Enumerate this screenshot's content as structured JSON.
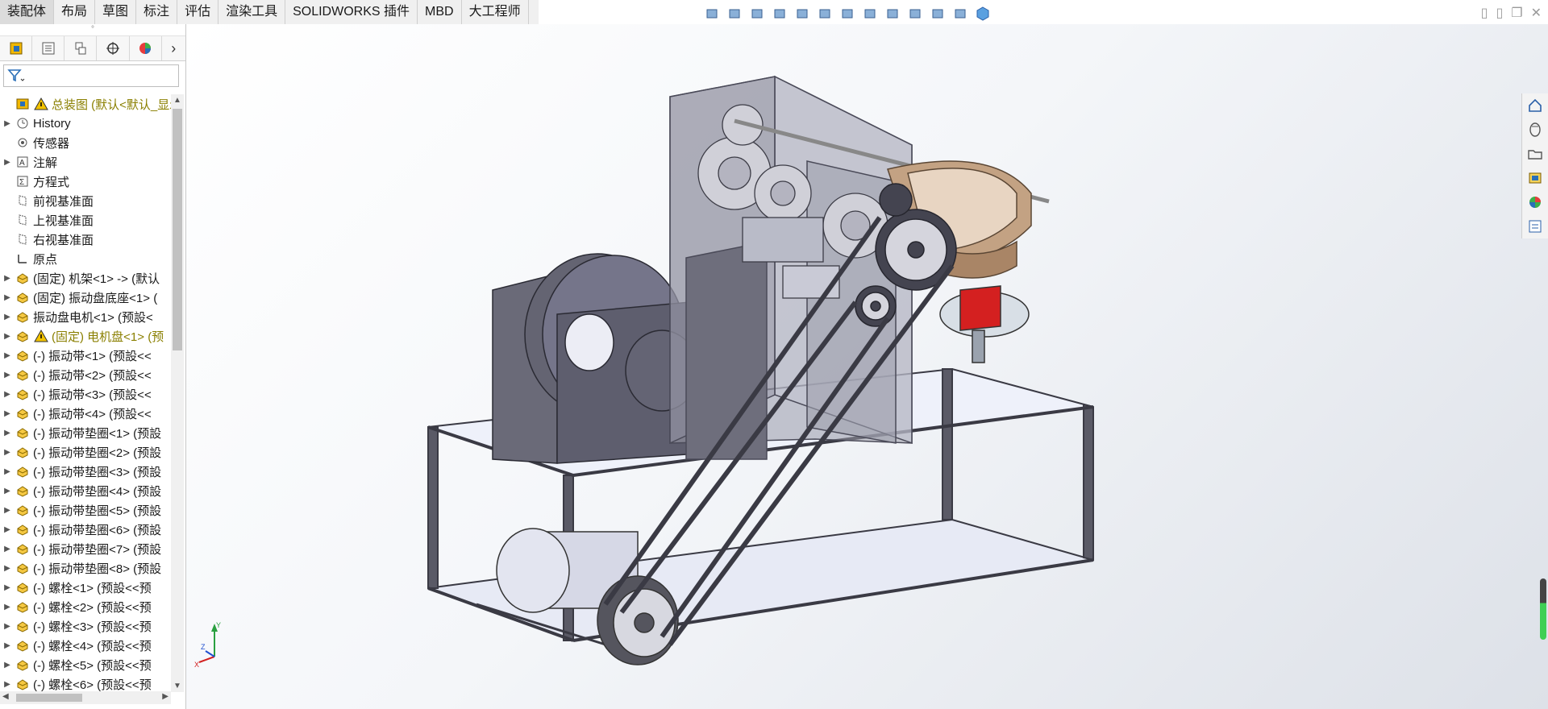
{
  "tabs": [
    {
      "label": "装配体",
      "active": true
    },
    {
      "label": "布局"
    },
    {
      "label": "草图"
    },
    {
      "label": "标注"
    },
    {
      "label": "评估"
    },
    {
      "label": "渲染工具"
    },
    {
      "label": "SOLIDWORKS 插件"
    },
    {
      "label": "MBD"
    },
    {
      "label": "大工程师"
    }
  ],
  "hud_icons": [
    "view-orientation-icon",
    "zoom-to-fit-icon",
    "zoom-area-icon",
    "previous-view-icon",
    "section-view-icon",
    "dynamic-annotation-icon",
    "view-orientation-dropdown-icon",
    "display-style-icon",
    "hide-show-icon",
    "edit-appearance-icon",
    "apply-scene-icon",
    "view-settings-icon",
    "cube-icon"
  ],
  "panel_tabs": [
    "feature-manager-icon",
    "property-manager-icon",
    "configuration-manager-icon",
    "dimxpert-icon",
    "display-manager-icon"
  ],
  "tree": [
    {
      "label": "总装图  (默认<默认_显示",
      "type": "root",
      "warn": true
    },
    {
      "label": "History",
      "type": "history",
      "expand": true
    },
    {
      "label": "传感器",
      "type": "sensor"
    },
    {
      "label": "注解",
      "type": "annotation",
      "expand": true
    },
    {
      "label": "方程式",
      "type": "equation"
    },
    {
      "label": "前视基准面",
      "type": "plane"
    },
    {
      "label": "上视基准面",
      "type": "plane"
    },
    {
      "label": "右视基准面",
      "type": "plane"
    },
    {
      "label": "原点",
      "type": "origin"
    },
    {
      "label": "(固定) 机架<1> -> (默认",
      "type": "part",
      "expand": true
    },
    {
      "label": "(固定) 振动盘底座<1> (",
      "type": "part",
      "expand": true
    },
    {
      "label": "振动盘电机<1> (预設<",
      "type": "part",
      "expand": true
    },
    {
      "label": "(固定) 电机盘<1> (预",
      "type": "part",
      "expand": true,
      "warn": true
    },
    {
      "label": "(-) 振动带<1> (预設<<",
      "type": "part",
      "expand": true
    },
    {
      "label": "(-) 振动带<2> (预設<<",
      "type": "part",
      "expand": true
    },
    {
      "label": "(-) 振动带<3> (预設<<",
      "type": "part",
      "expand": true
    },
    {
      "label": "(-) 振动带<4> (预設<<",
      "type": "part",
      "expand": true
    },
    {
      "label": "(-) 振动带垫圈<1> (预設",
      "type": "part",
      "expand": true
    },
    {
      "label": "(-) 振动带垫圈<2> (预設",
      "type": "part",
      "expand": true
    },
    {
      "label": "(-) 振动带垫圈<3> (预設",
      "type": "part",
      "expand": true
    },
    {
      "label": "(-) 振动带垫圈<4> (预設",
      "type": "part",
      "expand": true
    },
    {
      "label": "(-) 振动带垫圈<5> (预設",
      "type": "part",
      "expand": true
    },
    {
      "label": "(-) 振动带垫圈<6> (预設",
      "type": "part",
      "expand": true
    },
    {
      "label": "(-) 振动带垫圈<7> (预設",
      "type": "part",
      "expand": true
    },
    {
      "label": "(-) 振动带垫圈<8> (预設",
      "type": "part",
      "expand": true
    },
    {
      "label": "(-) 螺栓<1> (预設<<预",
      "type": "part",
      "expand": true
    },
    {
      "label": "(-) 螺栓<2> (预設<<预",
      "type": "part",
      "expand": true
    },
    {
      "label": "(-) 螺栓<3> (预設<<预",
      "type": "part",
      "expand": true
    },
    {
      "label": "(-) 螺栓<4> (预設<<预",
      "type": "part",
      "expand": true
    },
    {
      "label": "(-) 螺栓<5> (预設<<预",
      "type": "part",
      "expand": true
    },
    {
      "label": "(-) 螺栓<6> (预設<<预",
      "type": "part",
      "expand": true
    }
  ],
  "taskpane": [
    "home-icon",
    "design-library-icon",
    "file-explorer-icon",
    "view-palette-icon",
    "appearances-icon",
    "custom-properties-icon"
  ],
  "triad": {
    "x": "X",
    "y": "Y",
    "z": "Z"
  },
  "colors": {
    "frame": "#5a5a66",
    "frame_light": "#e8ecf6",
    "housing": "#9a9aa8",
    "gear": "#d0d0d8",
    "bowl": "#b08a6a",
    "motor_red": "#d42020"
  }
}
